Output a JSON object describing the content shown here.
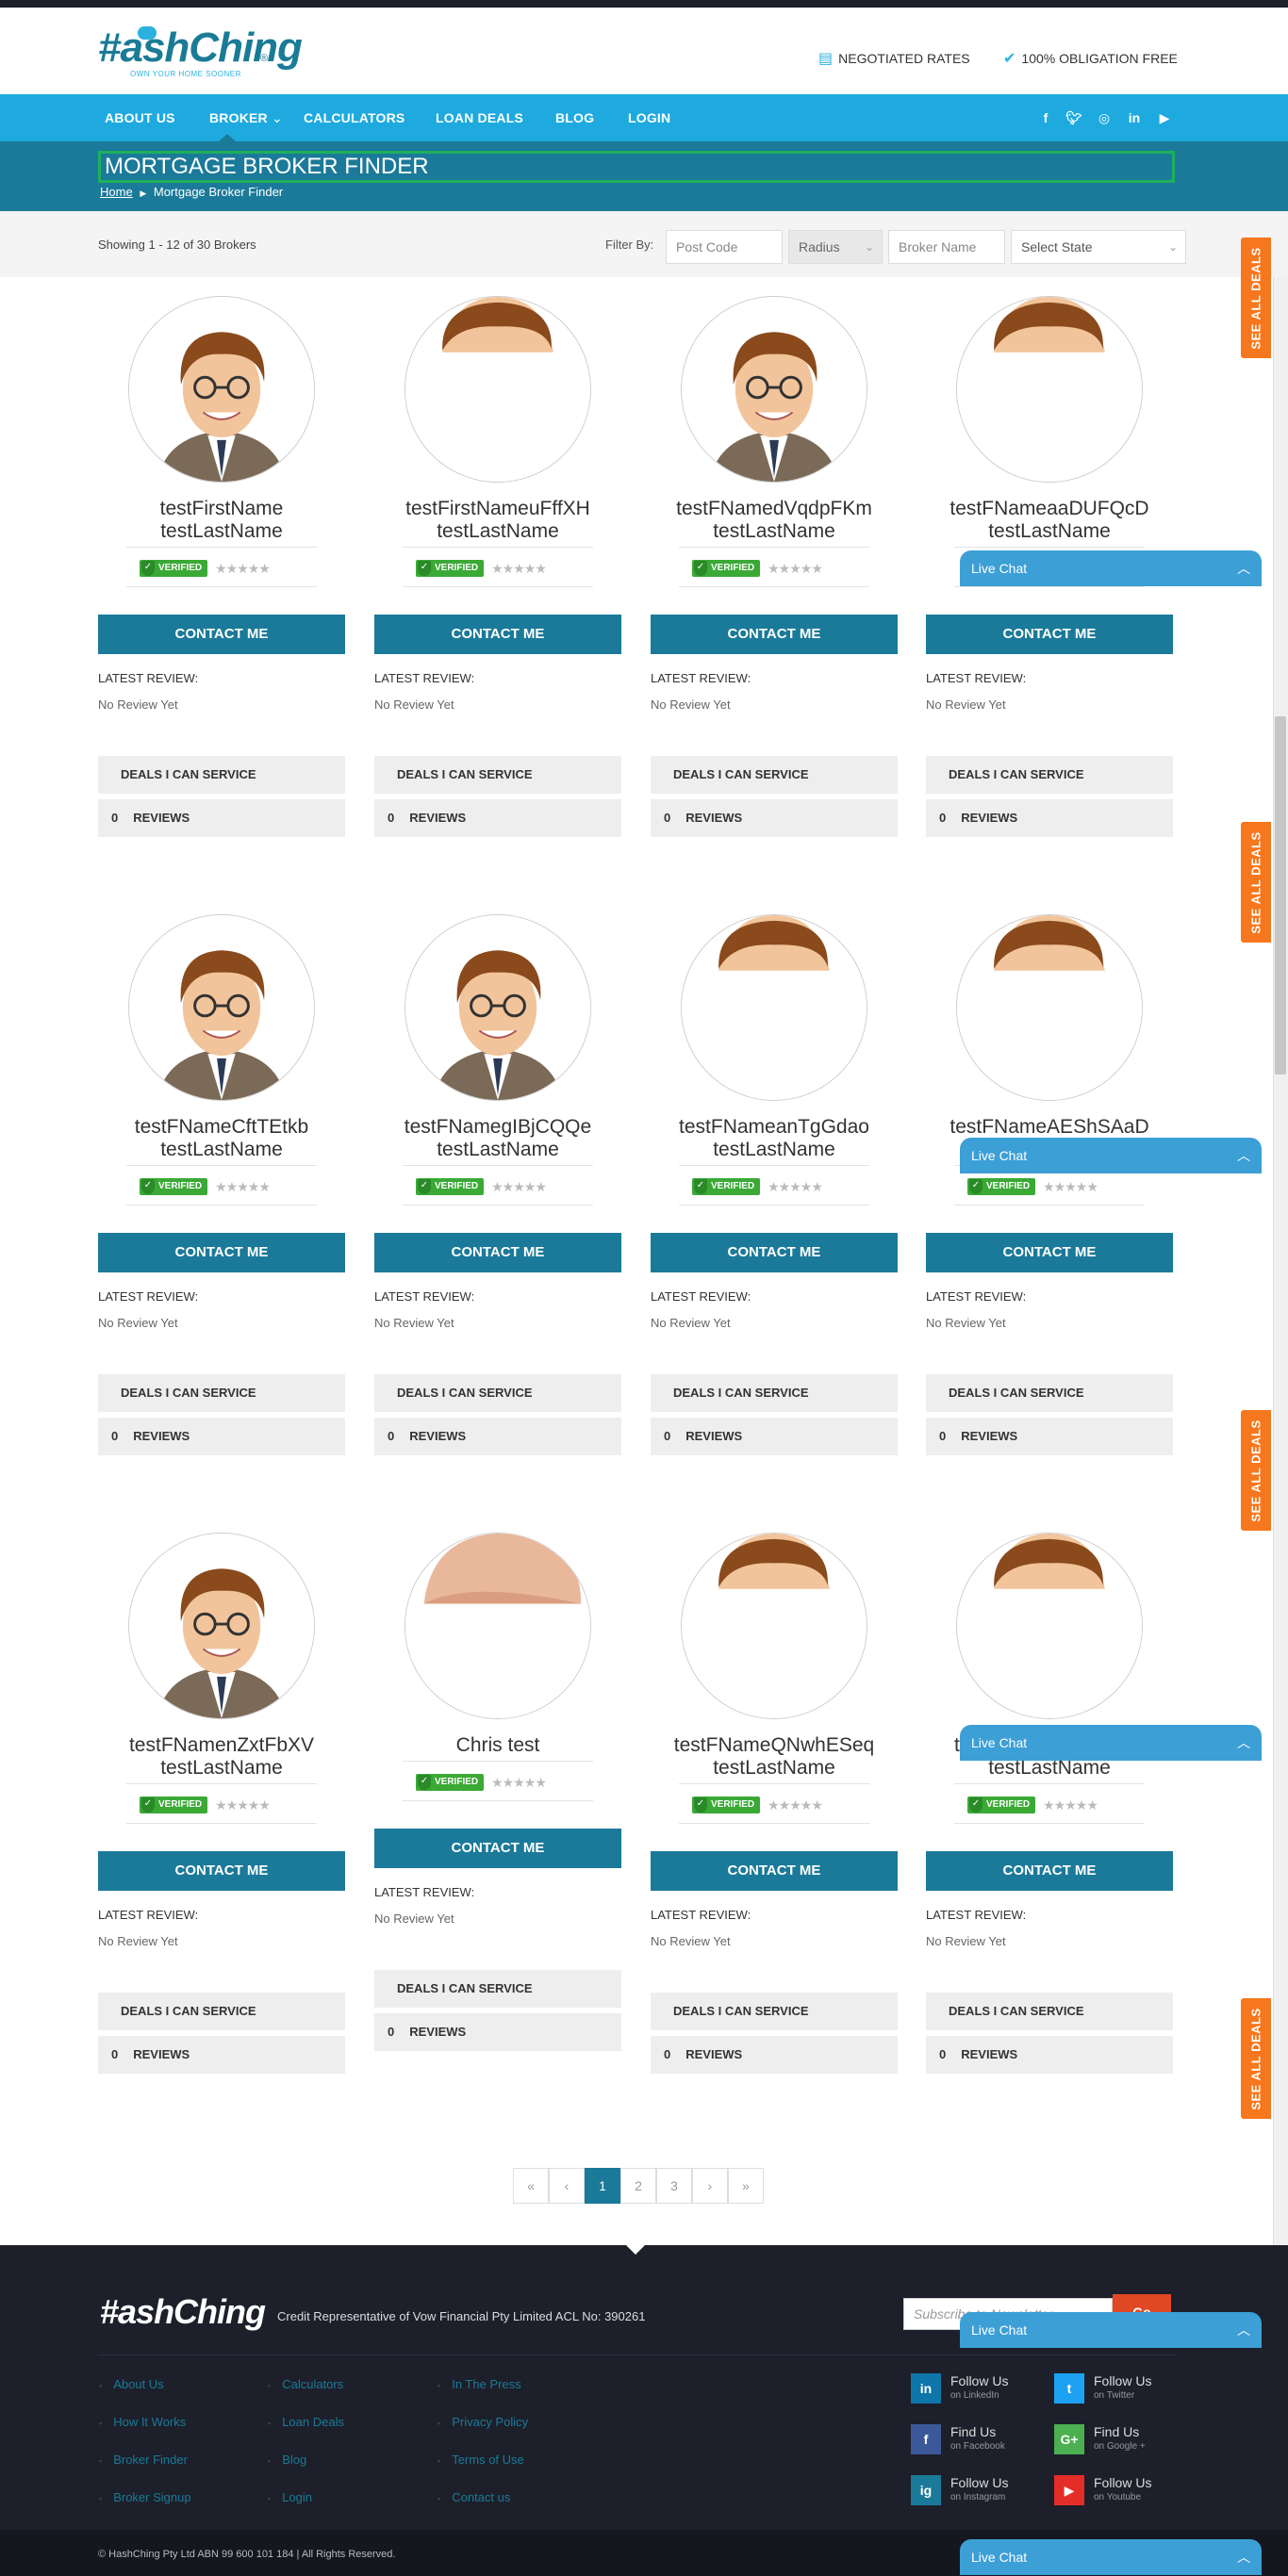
{
  "header": {
    "logo": "#ashChing",
    "logo_reg": "®",
    "logo_tagline": "OWN YOUR HOME SOONER",
    "badges": [
      "NEGOTIATED RATES",
      "100% OBLIGATION FREE"
    ]
  },
  "nav": {
    "items": [
      "ABOUT US",
      "BROKER",
      "CALCULATORS",
      "LOAN DEALS",
      "BLOG",
      "LOGIN"
    ],
    "social": [
      "f",
      "t",
      "ig",
      "in",
      "yt"
    ]
  },
  "page": {
    "title": "MORTGAGE BROKER FINDER",
    "breadcrumb_home": "Home",
    "breadcrumb_sep": "▶",
    "breadcrumb_current": "Mortgage Broker Finder"
  },
  "filter": {
    "showing": "Showing 1 - 12 of 30 Brokers",
    "label": "Filter By:",
    "postcode_placeholder": "Post Code",
    "radius": "Radius",
    "broker_placeholder": "Broker Name",
    "state": "Select State"
  },
  "see_all_deals": "SEE ALL DEALS",
  "card_labels": {
    "contact": "CONTACT ME",
    "latest_review": "LATEST REVIEW:",
    "no_review": "No Review Yet",
    "deals": "DEALS I CAN SERVICE",
    "reviews": "REVIEWS",
    "verified": "VERIFIED"
  },
  "brokers": [
    {
      "first": "testFirstName",
      "last": "testLastName",
      "photo": "cartoon",
      "reviews": "0"
    },
    {
      "first": "testFirstNameuFffXH",
      "last": "testLastName",
      "photo": "hair",
      "reviews": "0"
    },
    {
      "first": "testFNamedVqdpFKm",
      "last": "testLastName",
      "photo": "cartoon",
      "reviews": "0"
    },
    {
      "first": "testFNameaaDUFQcD",
      "last": "testLastName",
      "photo": "hair",
      "reviews": "0"
    },
    {
      "first": "testFNameCftTEtkb",
      "last": "testLastName",
      "photo": "cartoon",
      "reviews": "0"
    },
    {
      "first": "testFNamegIBjCQQe",
      "last": "testLastName",
      "photo": "cartoon",
      "reviews": "0"
    },
    {
      "first": "testFNameanTgGdao",
      "last": "testLastName",
      "photo": "hair",
      "reviews": "0"
    },
    {
      "first": "testFNameAEShSAaD",
      "last": "testLastName",
      "photo": "hair",
      "reviews": "0"
    },
    {
      "first": "testFNamenZxtFbXV",
      "last": "testLastName",
      "photo": "cartoon",
      "reviews": "0"
    },
    {
      "first": "Chris test",
      "last": "",
      "photo": "bald",
      "reviews": "0"
    },
    {
      "first": "testFNameQNwhESeq",
      "last": "testLastName",
      "photo": "hair",
      "reviews": "0"
    },
    {
      "first": "testFNameWJzAzoqv",
      "last": "testLastName",
      "photo": "hair",
      "reviews": "0"
    }
  ],
  "live_chat": "Live Chat",
  "pagination": [
    "«",
    "‹",
    "1",
    "2",
    "3",
    "›",
    "»"
  ],
  "pagination_active": "1",
  "footer": {
    "logo": "#ashChing",
    "credit": "Credit Representative of Vow Financial Pty Limited ACL No: 390261",
    "subscribe_placeholder": "Subscribe to Newsletter",
    "go": "Go",
    "col1": [
      "About Us",
      "How It Works",
      "Broker Finder",
      "Broker Signup"
    ],
    "col2": [
      "Calculators",
      "Loan Deals",
      "Blog",
      "Login"
    ],
    "col3": [
      "In The Press",
      "Privacy Policy",
      "Terms of Use",
      "Contact us"
    ],
    "follow": [
      {
        "t1": "Follow Us",
        "t2": "on LinkedIn",
        "icon": "in",
        "color": "#0e76a8"
      },
      {
        "t1": "Follow Us",
        "t2": "on Twitter",
        "icon": "t",
        "color": "#1da1f2"
      },
      {
        "t1": "Find Us",
        "t2": "on Facebook",
        "icon": "f",
        "color": "#3b5998"
      },
      {
        "t1": "Find Us",
        "t2": "on Google +",
        "icon": "G+",
        "color": "#4caf50"
      },
      {
        "t1": "Follow Us",
        "t2": "on Instagram",
        "icon": "ig",
        "color": "#1b7a99"
      },
      {
        "t1": "Follow Us",
        "t2": "on Youtube",
        "icon": "▶",
        "color": "#e52d27"
      }
    ],
    "copyright": "© HashChing Pty Ltd  ABN 99 600 101 184  |  All Rights Reserved."
  },
  "colors": {
    "nav": "#1eaadf",
    "titlebar": "#1b7a99",
    "contact_btn": "#1b7a99",
    "deals_tab": "#f7771e",
    "live_chat": "#3c9fd6",
    "verified": "#3aa935",
    "footer": "#1d1f2b"
  }
}
